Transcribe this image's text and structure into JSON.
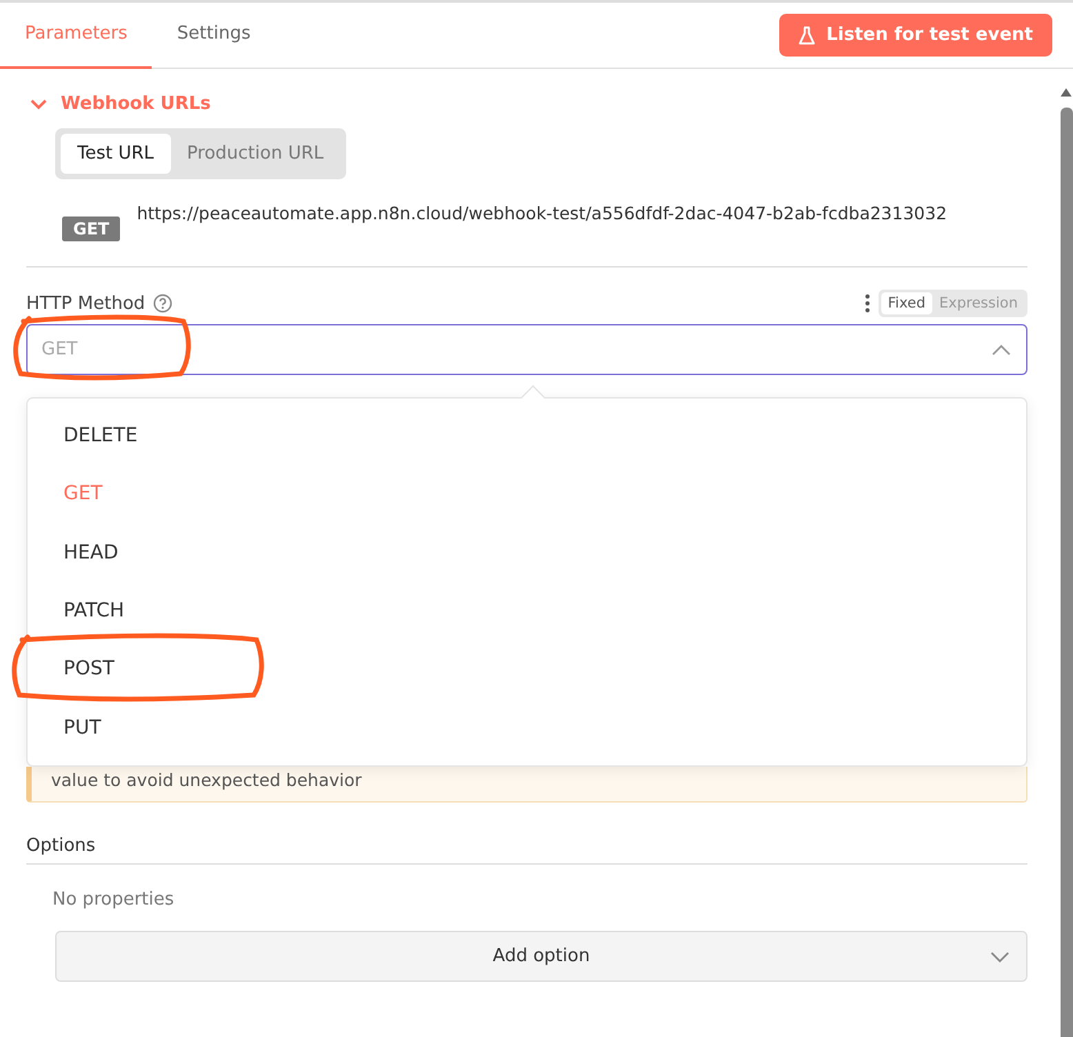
{
  "tabs": [
    {
      "label": "Parameters",
      "selected": true
    },
    {
      "label": "Settings",
      "selected": false
    }
  ],
  "listen_button": {
    "label": "Listen for test event"
  },
  "webhook_urls": {
    "title": "Webhook URLs",
    "expanded": true,
    "url_tabs": [
      {
        "label": "Test URL",
        "selected": true
      },
      {
        "label": "Production URL",
        "selected": false
      }
    ],
    "method_badge": "GET",
    "url": "https://peaceautomate.app.n8n.cloud/webhook-test/a556dfdf-2dac-4047-b2ab-fcdba2313032"
  },
  "http_method": {
    "label": "HTTP Method",
    "mode_tabs": [
      {
        "label": "Fixed",
        "selected": true
      },
      {
        "label": "Expression",
        "selected": false
      }
    ],
    "placeholder": "GET",
    "highlighted": true,
    "options": [
      {
        "label": "DELETE",
        "selected": false,
        "highlighted": false
      },
      {
        "label": "GET",
        "selected": true,
        "highlighted": false
      },
      {
        "label": "HEAD",
        "selected": false,
        "highlighted": false
      },
      {
        "label": "PATCH",
        "selected": false,
        "highlighted": false
      },
      {
        "label": "POST",
        "selected": false,
        "highlighted": true
      },
      {
        "label": "PUT",
        "selected": false,
        "highlighted": false
      }
    ]
  },
  "warning": {
    "text": "value to avoid unexpected behavior"
  },
  "options_section": {
    "title": "Options",
    "empty_text": "No properties",
    "add_button": "Add option"
  }
}
